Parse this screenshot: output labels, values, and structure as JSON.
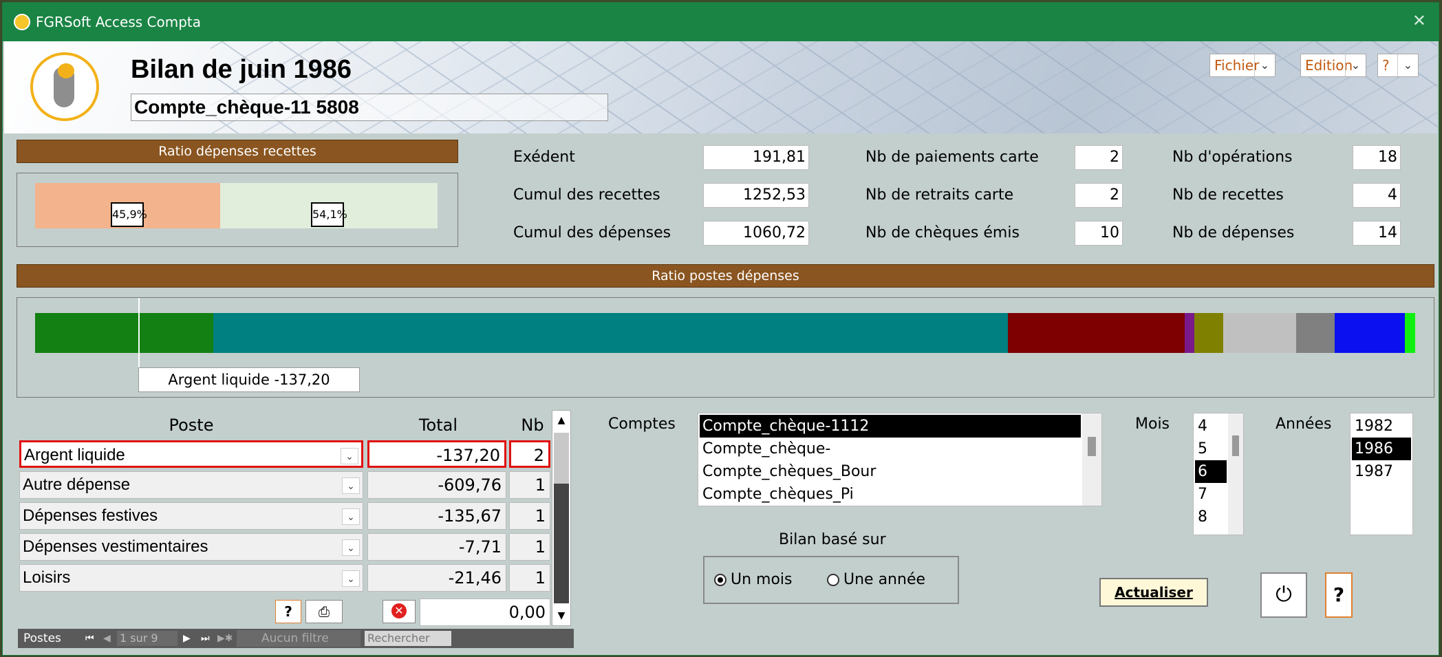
{
  "window": {
    "title": "FGRSoft Access Compta",
    "close_glyph": "✕"
  },
  "header": {
    "title": "Bilan de juin 1986",
    "account": "Compte_chèque-11 5808"
  },
  "menus": {
    "file": "Fichier",
    "edit": "Edition",
    "help": "?",
    "dd_glyph": "⌄"
  },
  "ratio_income": {
    "label": "Ratio dépenses recettes",
    "expenses_pct": "45,9%",
    "income_pct": "54,1%",
    "expenses_fraction": 0.459,
    "income_fraction": 0.541,
    "expenses_color": "#f3b38c",
    "income_color": "#e1eedc"
  },
  "stats": {
    "excedent_label": "Exédent",
    "excedent": "191,81",
    "recettes_label": "Cumul des recettes",
    "recettes": "1252,53",
    "depenses_label": "Cumul des dépenses",
    "depenses": "1060,72",
    "card_pay_label": "Nb de paiements carte",
    "card_pay": "2",
    "card_withdraw_label": "Nb de retraits carte",
    "card_withdraw": "2",
    "cheques_label": "Nb de chèques émis",
    "cheques": "10",
    "ops_label": "Nb d'opérations",
    "ops": "18",
    "nb_recettes_label": "Nb de recettes",
    "nb_recettes": "4",
    "nb_depenses_label": "Nb de dépenses",
    "nb_depenses": "14"
  },
  "ratio_posts": {
    "label": "Ratio postes dépenses",
    "segments": [
      {
        "fraction": 0.129,
        "color": "#128012"
      },
      {
        "fraction": 0.576,
        "color": "#008080"
      },
      {
        "fraction": 0.128,
        "color": "#7f0000"
      },
      {
        "fraction": 0.007,
        "color": "#7a1a8a"
      },
      {
        "fraction": 0.021,
        "color": "#808000"
      },
      {
        "fraction": 0.053,
        "color": "#c0c0c0"
      },
      {
        "fraction": 0.028,
        "color": "#808080"
      },
      {
        "fraction": 0.051,
        "color": "#0a10f0"
      },
      {
        "fraction": 0.007,
        "color": "#10f010"
      }
    ],
    "tooltip": "Argent liquide  -137,20"
  },
  "grid": {
    "col_poste": "Poste",
    "col_total": "Total",
    "col_nb": "Nb",
    "rows": [
      {
        "poste": "Argent liquide",
        "total": "-137,20",
        "nb": "2"
      },
      {
        "poste": "Autre dépense",
        "total": "-609,76",
        "nb": "1"
      },
      {
        "poste": "Dépenses festives",
        "total": "-135,67",
        "nb": "1"
      },
      {
        "poste": "Dépenses vestimentaires",
        "total": "-7,71",
        "nb": "1"
      },
      {
        "poste": "Loisirs",
        "total": "-21,46",
        "nb": "1"
      }
    ],
    "footer_total": "0,00",
    "help_label": "?",
    "nav": {
      "label": "Postes",
      "record": "1 sur 9",
      "filter": "Aucun filtre",
      "search_placeholder": "Rechercher"
    }
  },
  "comptes": {
    "label": "Comptes",
    "items": [
      "Compte_chèque-1112 ",
      "Compte_chèque-",
      "Compte_chèques_Bour",
      "Compte_chèques_Pi"
    ]
  },
  "mois": {
    "label": "Mois",
    "items": [
      "4",
      "5",
      "6",
      "7",
      "8"
    ],
    "selected": "6"
  },
  "annees": {
    "label": "Années",
    "items": [
      "1982",
      "1986",
      "1987"
    ],
    "selected": "1986"
  },
  "bilan": {
    "label": "Bilan basé sur",
    "opt_month": "Un mois",
    "opt_year": "Une année"
  },
  "actions": {
    "refresh": "Actualiser",
    "help": "?"
  }
}
